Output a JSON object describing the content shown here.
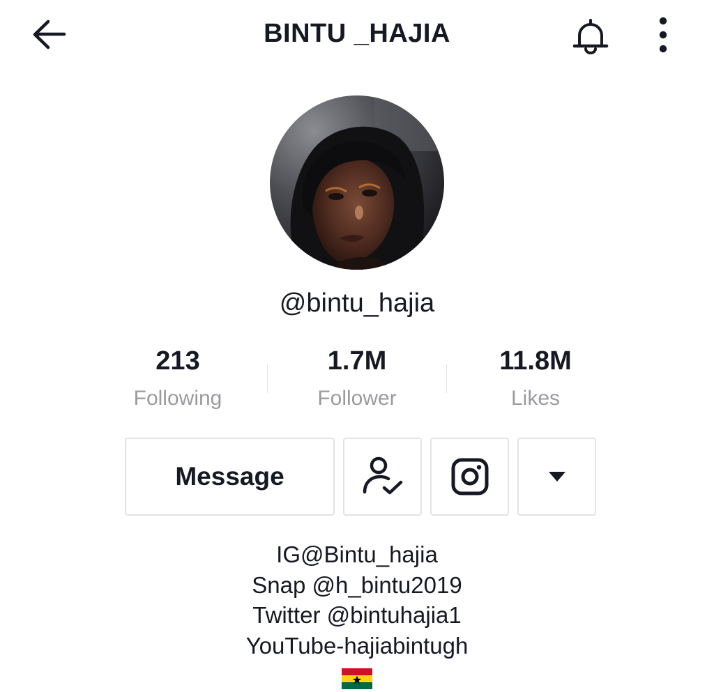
{
  "header": {
    "title": "BINTU _HAJIA",
    "back_icon": "arrow-left-icon",
    "bell_icon": "bell-icon",
    "more_icon": "more-vertical-icon"
  },
  "profile": {
    "username": "@bintu_hajia",
    "avatar_icon": "profile-photo"
  },
  "stats": [
    {
      "value": "213",
      "label": "Following"
    },
    {
      "value": "1.7M",
      "label": "Follower"
    },
    {
      "value": "11.8M",
      "label": "Likes"
    }
  ],
  "actions": {
    "message_label": "Message",
    "friends_icon": "user-check-icon",
    "instagram_icon": "instagram-icon",
    "dropdown_icon": "caret-down-icon"
  },
  "bio": [
    "IG@Bintu_hajia",
    "Snap @h_bintu2019",
    "Twitter @bintuhajia1",
    "YouTube-hajiabintugh"
  ],
  "bio_flag": "ghana-flag",
  "colors": {
    "text_primary": "#161823",
    "text_secondary": "#9a9ba0",
    "border": "#e3e3e4"
  }
}
